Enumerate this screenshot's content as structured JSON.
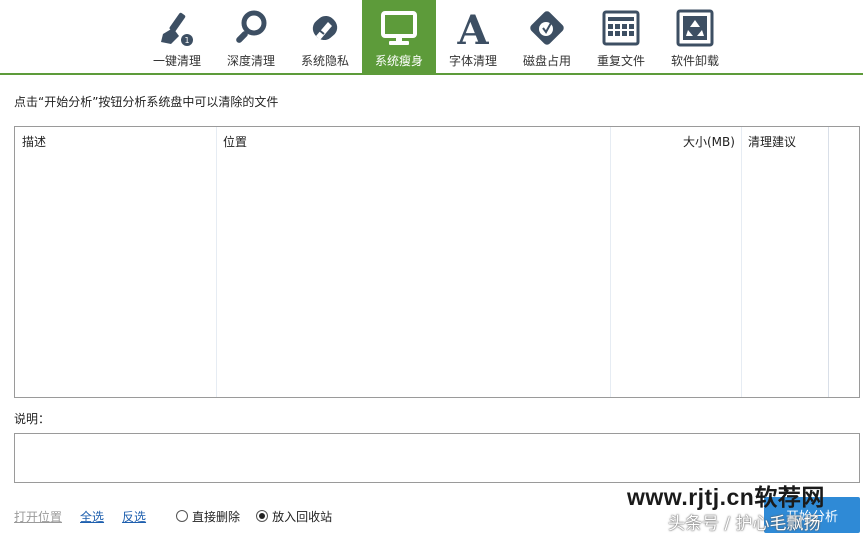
{
  "toolbar": {
    "tabs": [
      {
        "label": "一键清理",
        "icon": "broom-icon"
      },
      {
        "label": "深度清理",
        "icon": "magnifier-icon"
      },
      {
        "label": "系统隐私",
        "icon": "eraser-icon"
      },
      {
        "label": "系统瘦身",
        "icon": "monitor-icon",
        "active": true
      },
      {
        "label": "字体清理",
        "icon": "font-icon"
      },
      {
        "label": "磁盘占用",
        "icon": "disk-icon"
      },
      {
        "label": "重复文件",
        "icon": "duplicate-files-icon"
      },
      {
        "label": "软件卸载",
        "icon": "recycle-icon"
      }
    ],
    "accent_color": "#5d9b3a",
    "icon_color": "#3d4f63"
  },
  "hint": "点击“开始分析”按钮分析系统盘中可以清除的文件",
  "table": {
    "columns": [
      "描述",
      "位置",
      "大小(MB)",
      "清理建议"
    ],
    "rows": []
  },
  "description_label": "说明：",
  "bottom": {
    "open_location": "打开位置",
    "select_all": "全选",
    "invert_selection": "反选",
    "radio_delete": "直接删除",
    "radio_recycle": "放入回收站",
    "selected_option": "放入回收站",
    "start_button": "开始分析",
    "button_color": "#2f8ad6"
  },
  "watermarks": {
    "site": "www.rjtj.cn软荐网",
    "author": "头条号 / 护心毛飘扬"
  }
}
